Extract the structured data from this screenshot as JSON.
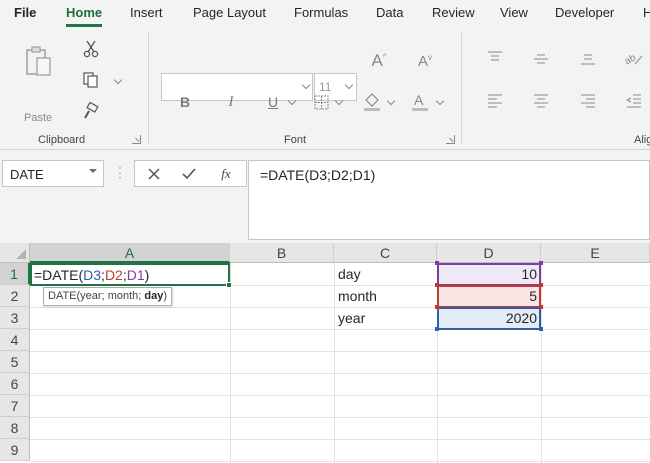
{
  "tabs": [
    "File",
    "Home",
    "Insert",
    "Page Layout",
    "Formulas",
    "Data",
    "Review",
    "View",
    "Developer",
    "H"
  ],
  "active_tab": "Home",
  "ribbon": {
    "clipboard_label": "Clipboard",
    "paste_label": "Paste",
    "font_label": "Font",
    "font_size": "11",
    "alignment_label": "Alig"
  },
  "formula_bar": {
    "name_box": "DATE",
    "formula": "=DATE(D3;D2;D1)"
  },
  "grid": {
    "columns": [
      "A",
      "B",
      "C",
      "D",
      "E"
    ],
    "rows": [
      "1",
      "2",
      "3",
      "4",
      "5",
      "6",
      "7",
      "8",
      "9"
    ],
    "cells": {
      "A1_prefix": "=DATE(",
      "A1_ref1": "D3",
      "A1_sep1": ";",
      "A1_ref2": "D2",
      "A1_sep2": ";",
      "A1_ref3": "D1",
      "A1_suffix": ")",
      "C1": "day",
      "C2": "month",
      "C3": "year",
      "D1": "10",
      "D2": "5",
      "D3": "2020"
    },
    "tooltip": {
      "prefix": "DATE(year; month; ",
      "bold": "day",
      "suffix": ")"
    }
  },
  "colors": {
    "accent": "#217346",
    "ref_d3": "#2f5fa8",
    "ref_d2": "#c0392b",
    "ref_d1": "#7b3fa0"
  }
}
